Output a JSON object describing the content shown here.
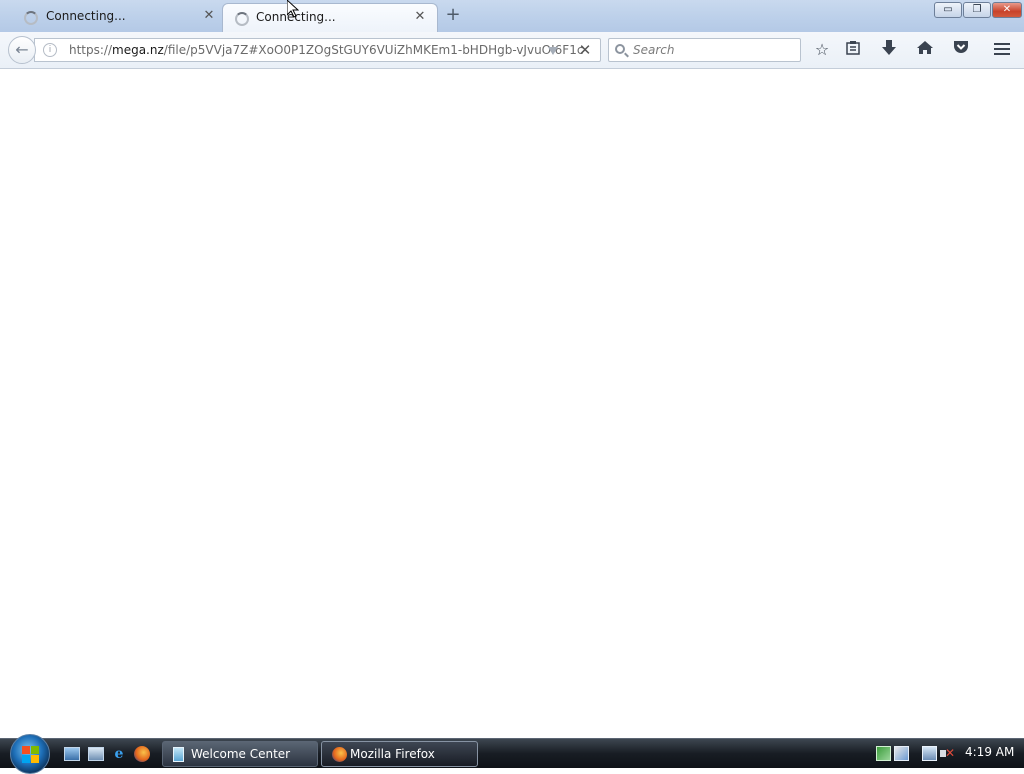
{
  "browser": {
    "tabs": [
      {
        "label": "Connecting...",
        "active": false
      },
      {
        "label": "Connecting...",
        "active": true
      }
    ],
    "new_tab_label": "+",
    "window_controls": {
      "minimize": "▭",
      "restore": "❐",
      "close": "✕"
    },
    "url_bar": {
      "url_prefix": "https://",
      "url_host": "mega.nz",
      "url_path": "/file/p5VVja7Z#XoO0P1ZOgStGUY6VUiZhMKEm1-bHDHgb-vJvuOI6F1c"
    },
    "search": {
      "placeholder": "Search"
    },
    "toolbar_icons": [
      "bookmark-star-icon",
      "reading-list-icon",
      "downloads-icon",
      "home-icon",
      "pocket-icon",
      "menu-icon"
    ]
  },
  "taskbar": {
    "tasks": [
      {
        "label": "Welcome Center",
        "active": false
      },
      {
        "label": "Mozilla Firefox",
        "active": true
      }
    ],
    "clock": "4:19 AM"
  },
  "colors": {
    "tabstrip": "#bcd0ea",
    "taskbar": "#181d24",
    "close_button": "#c8432b"
  }
}
